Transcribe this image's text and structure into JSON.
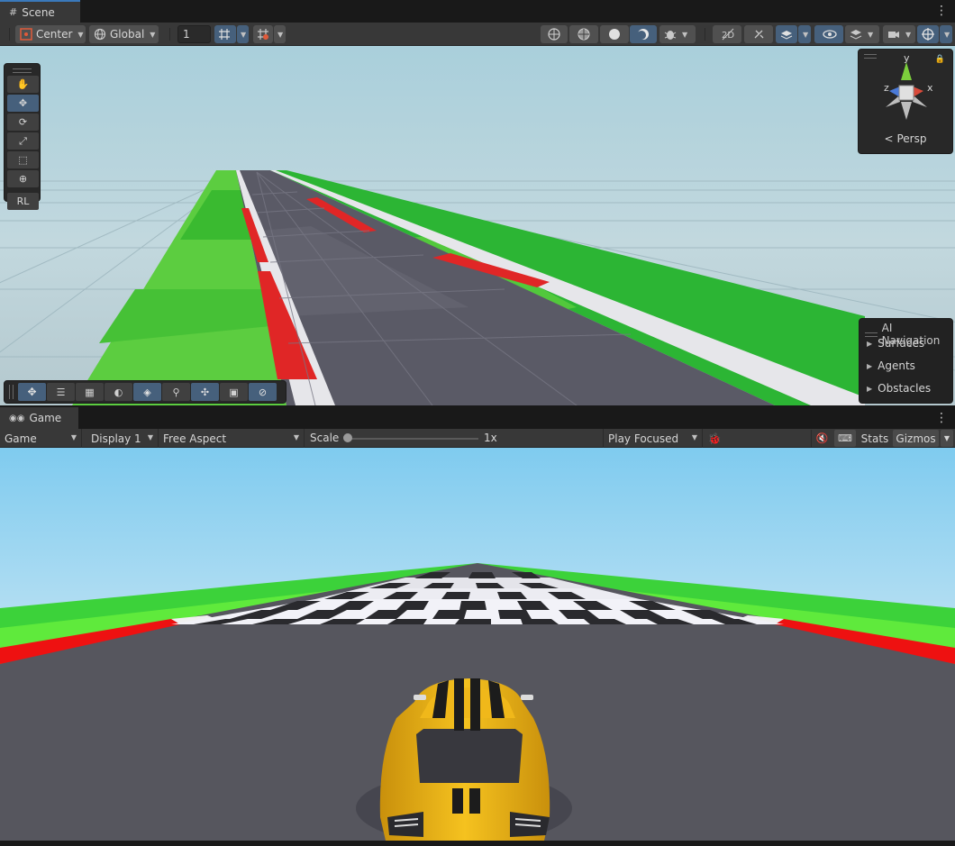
{
  "scene": {
    "tab_label": "Scene",
    "toolbar": {
      "pivot_mode": "Center",
      "pivot_rotation": "Global",
      "grid_size": "1"
    },
    "tools": {
      "rl_label": "RL"
    },
    "gizmo": {
      "axis_y": "y",
      "axis_x": "x",
      "axis_z": "z",
      "projection_label": "Persp"
    },
    "ai_navigation": {
      "title": "AI Navigation",
      "items": [
        "Surfaces",
        "Agents",
        "Obstacles"
      ]
    }
  },
  "game": {
    "tab_label": "Game",
    "toolbar": {
      "view_mode": "Game",
      "display": "Display 1",
      "aspect": "Free Aspect",
      "scale_label": "Scale",
      "scale_value": "1x",
      "play_mode": "Play Focused",
      "stats_label": "Stats",
      "gizmos_label": "Gizmos"
    }
  },
  "colors": {
    "accent": "#3a79bb",
    "active_button": "#46607c",
    "panel_bg": "#383838",
    "grass_light": "#66cc44",
    "grass_dark": "#22aa22",
    "kerb_red": "#e01a1a",
    "road": "#55555d",
    "car_yellow": "#f2b81c"
  }
}
